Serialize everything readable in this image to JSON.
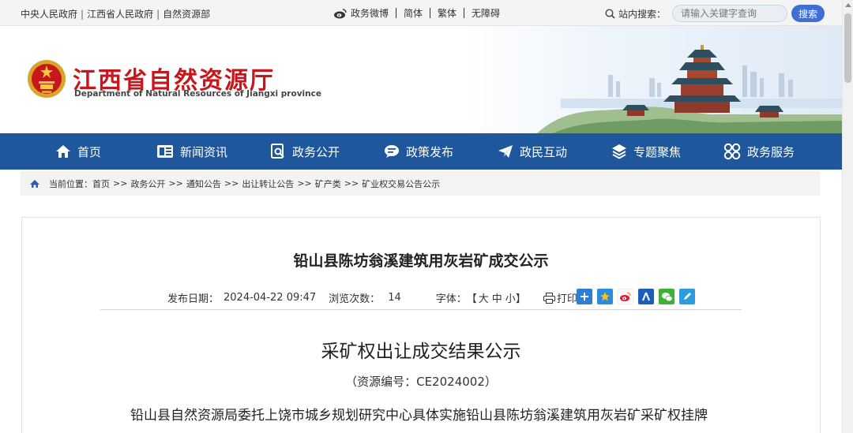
{
  "topbar": {
    "links": [
      "中央人民政府",
      "江西省人民政府",
      "自然资源部"
    ],
    "separator": "|",
    "weibo": "政务微博",
    "simplified": "简体",
    "traditional": "繁体",
    "accessibility": "无障碍",
    "search_label": "站内搜索：",
    "search_placeholder": "请输入关键字查询",
    "search_button": "搜索"
  },
  "header": {
    "site_name": "江西省自然资源厅",
    "site_name_en": "Department of Natural Resources of Jiangxi province"
  },
  "nav": {
    "items": [
      {
        "label": "首页",
        "icon": "home-icon"
      },
      {
        "label": "新闻资讯",
        "icon": "news-icon"
      },
      {
        "label": "政务公开",
        "icon": "document-search-icon"
      },
      {
        "label": "政策发布",
        "icon": "speech-bubble-icon"
      },
      {
        "label": "政民互动",
        "icon": "paper-plane-icon"
      },
      {
        "label": "专题聚焦",
        "icon": "layers-icon"
      },
      {
        "label": "政务服务",
        "icon": "grid-circles-icon"
      }
    ]
  },
  "breadcrumb": {
    "prefix": "当前位置：",
    "items": [
      "首页",
      "政务公开",
      "通知公告",
      "出让转让公告",
      "矿产类",
      "矿业权交易公告公示"
    ],
    "arrow": ">>"
  },
  "article": {
    "title": "铅山县陈坊翁溪建筑用灰岩矿成交公示",
    "date_label": "发布日期：",
    "date": "2024-04-22 09:47",
    "views_label": "浏览次数：",
    "views": "14",
    "font_label": "字体：",
    "font_open": "【",
    "font_large": "大",
    "font_medium": "中",
    "font_small": "小",
    "font_close": "】",
    "print": "打印",
    "share_icons": [
      "share-plus-icon",
      "qzone-icon",
      "weibo-icon",
      "renren-icon",
      "wechat-icon",
      "edit-icon"
    ],
    "subheading": "采矿权出让成交结果公示",
    "resource_no": "（资源编号：CE2024002）",
    "body": "铅山县自然资源局委托上饶市城乡规划研究中心具体实施铅山县陈坊翁溪建筑用灰岩矿采矿权挂牌"
  },
  "colors": {
    "nav_bg": "#1f579d",
    "brand_red": "#c8161d",
    "search_button": "#3f6fd6"
  }
}
